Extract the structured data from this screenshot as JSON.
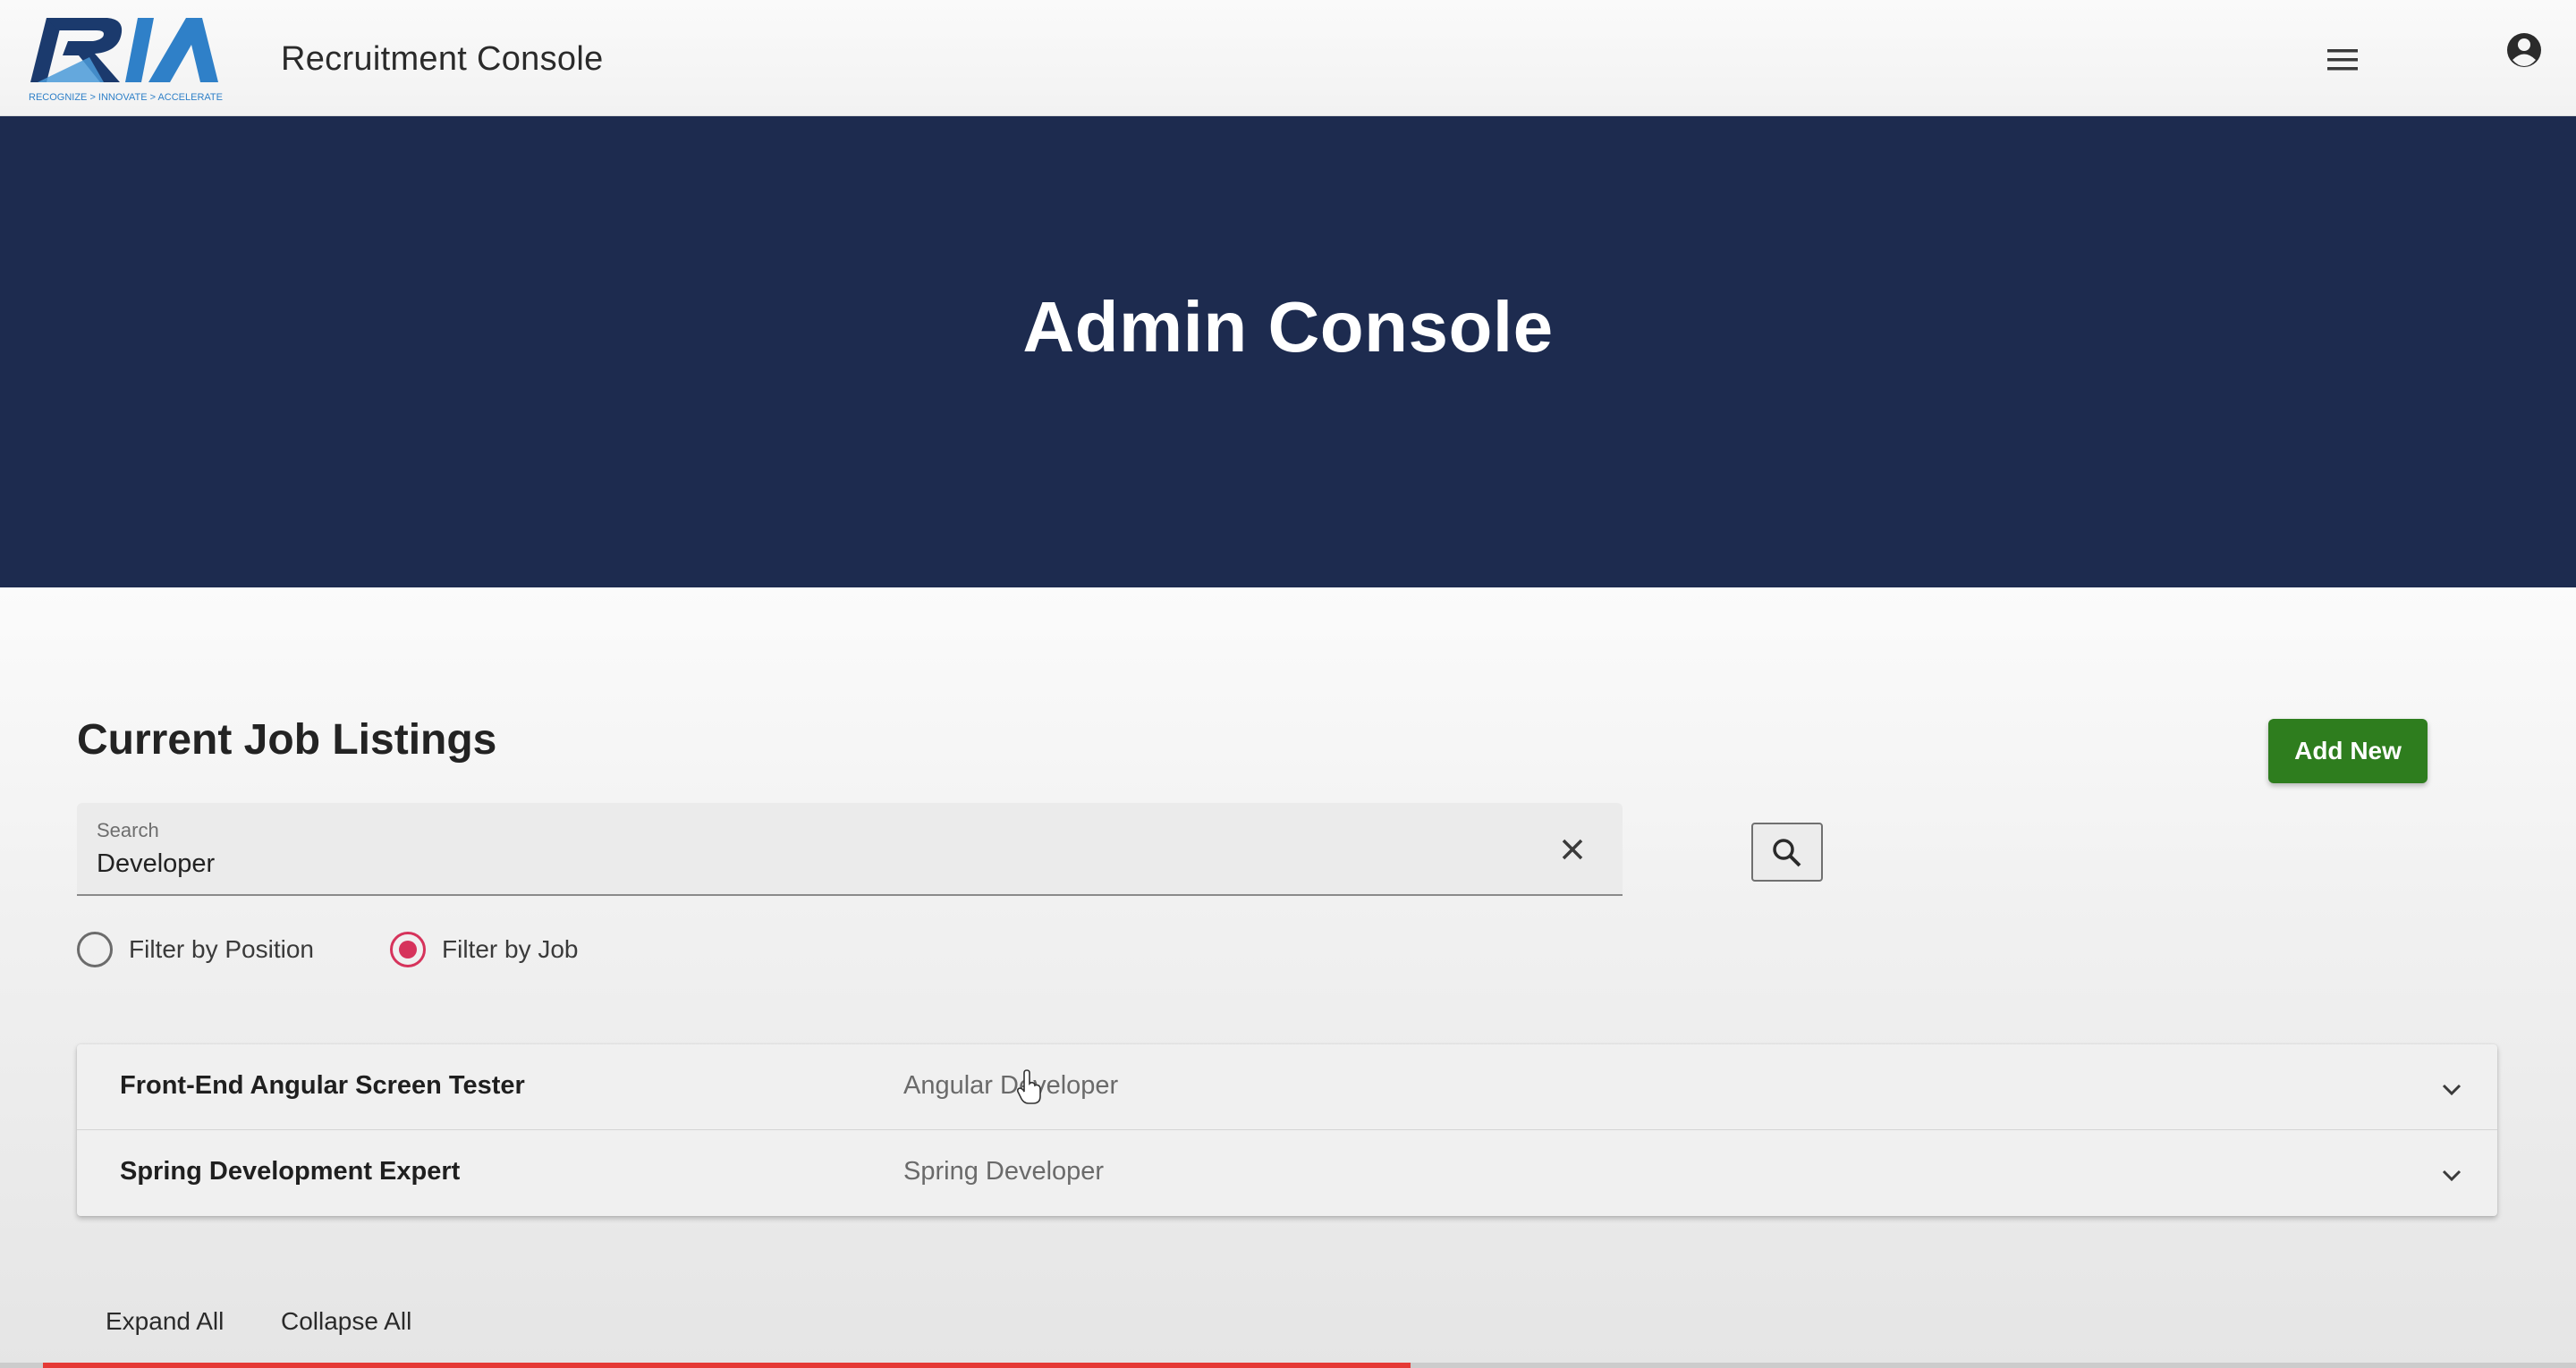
{
  "header": {
    "logo_text": "RIA",
    "logo_tagline": "RECOGNIZE > INNOVATE > ACCELERATE",
    "app_title": "Recruitment Console",
    "menu_icon": "hamburger-menu-icon",
    "account_icon": "account-circle-icon"
  },
  "hero": {
    "title": "Admin Console"
  },
  "listings": {
    "title": "Current Job Listings",
    "add_button_label": "Add New",
    "search": {
      "label": "Search",
      "value": "Developer",
      "clear_icon": "close-icon",
      "submit_icon": "search-icon"
    },
    "filters": [
      {
        "label": "Filter by Position",
        "checked": false
      },
      {
        "label": "Filter by Job",
        "checked": true
      }
    ],
    "items": [
      {
        "position": "Front-End Angular Screen Tester",
        "job": "Angular Developer"
      },
      {
        "position": "Spring Development Expert",
        "job": "Spring Developer"
      }
    ],
    "expand_all_label": "Expand All",
    "collapse_all_label": "Collapse All"
  },
  "video_progress": 0.54,
  "colors": {
    "hero_bg": "#1d2b4f",
    "add_button": "#2e7d1e",
    "radio_accent": "#d6335b",
    "progress": "#e53935"
  }
}
